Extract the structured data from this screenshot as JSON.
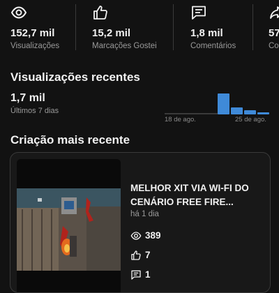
{
  "stats": [
    {
      "icon": "eye-icon",
      "value": "152,7 mil",
      "label": "Visualizações"
    },
    {
      "icon": "thumbs-up-icon",
      "value": "15,2 mil",
      "label": "Marcações Gostei"
    },
    {
      "icon": "comment-icon",
      "value": "1,8 mil",
      "label": "Comentários"
    },
    {
      "icon": "share-icon",
      "value": "57",
      "label": "Co"
    }
  ],
  "recent": {
    "title": "Visualizações recentes",
    "value": "1,7 mil",
    "period": "Últimos 7 dias",
    "chart_start_label": "18 de ago.",
    "chart_end_label": "25 de ago.",
    "accent_color": "#3f8ad8"
  },
  "latest": {
    "title": "Criação mais recente",
    "video_title": "MELHOR XIT VIA WI-FI DO CENÁRIO FREE FIRE...",
    "age": "há 1 dia",
    "views": "389",
    "likes": "7",
    "comments": "1"
  }
}
